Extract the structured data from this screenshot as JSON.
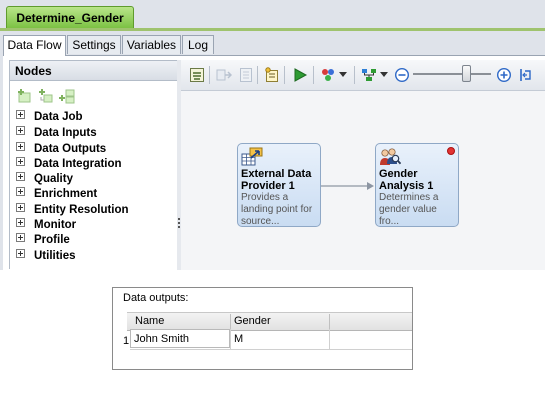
{
  "job_tab": {
    "label": "Determine_Gender"
  },
  "tabs": [
    {
      "label": "Data Flow",
      "active": true
    },
    {
      "label": "Settings",
      "active": false
    },
    {
      "label": "Variables",
      "active": false
    },
    {
      "label": "Log",
      "active": false
    }
  ],
  "nodes_panel": {
    "title": "Nodes",
    "tools": [
      "add-node-icon",
      "add-child-icon",
      "add-sibling-icon"
    ],
    "categories": [
      "Data Job",
      "Data Inputs",
      "Data Outputs",
      "Data Integration",
      "Quality",
      "Enrichment",
      "Entity Resolution",
      "Monitor",
      "Profile",
      "Utilities"
    ]
  },
  "toolbar": {
    "icons": [
      "properties-icon",
      "import-icon",
      "notes-icon",
      "attach-icon",
      "run-icon",
      "node-actions-icon",
      "layout-icon",
      "zoom-out-icon",
      "zoom-in-icon",
      "reset-zoom-icon"
    ],
    "zoom_level": 0.68
  },
  "flow": {
    "nodes": [
      {
        "title": "External Data Provider 1",
        "description": "Provides a landing point for source...",
        "icon": "external-data-icon",
        "has_error": false
      },
      {
        "title": "Gender Analysis 1",
        "description": "Determines a gender value fro...",
        "icon": "gender-analysis-icon",
        "has_error": true
      }
    ]
  },
  "data_outputs": {
    "title": "Data outputs:",
    "columns": [
      "Name",
      "Gender"
    ],
    "rows": [
      {
        "index": "1",
        "cells": [
          "John Smith",
          "M"
        ]
      }
    ]
  },
  "colors": {
    "job_tab": "#79c040",
    "node_card": "#c9dcf2",
    "error": "#e23333"
  }
}
